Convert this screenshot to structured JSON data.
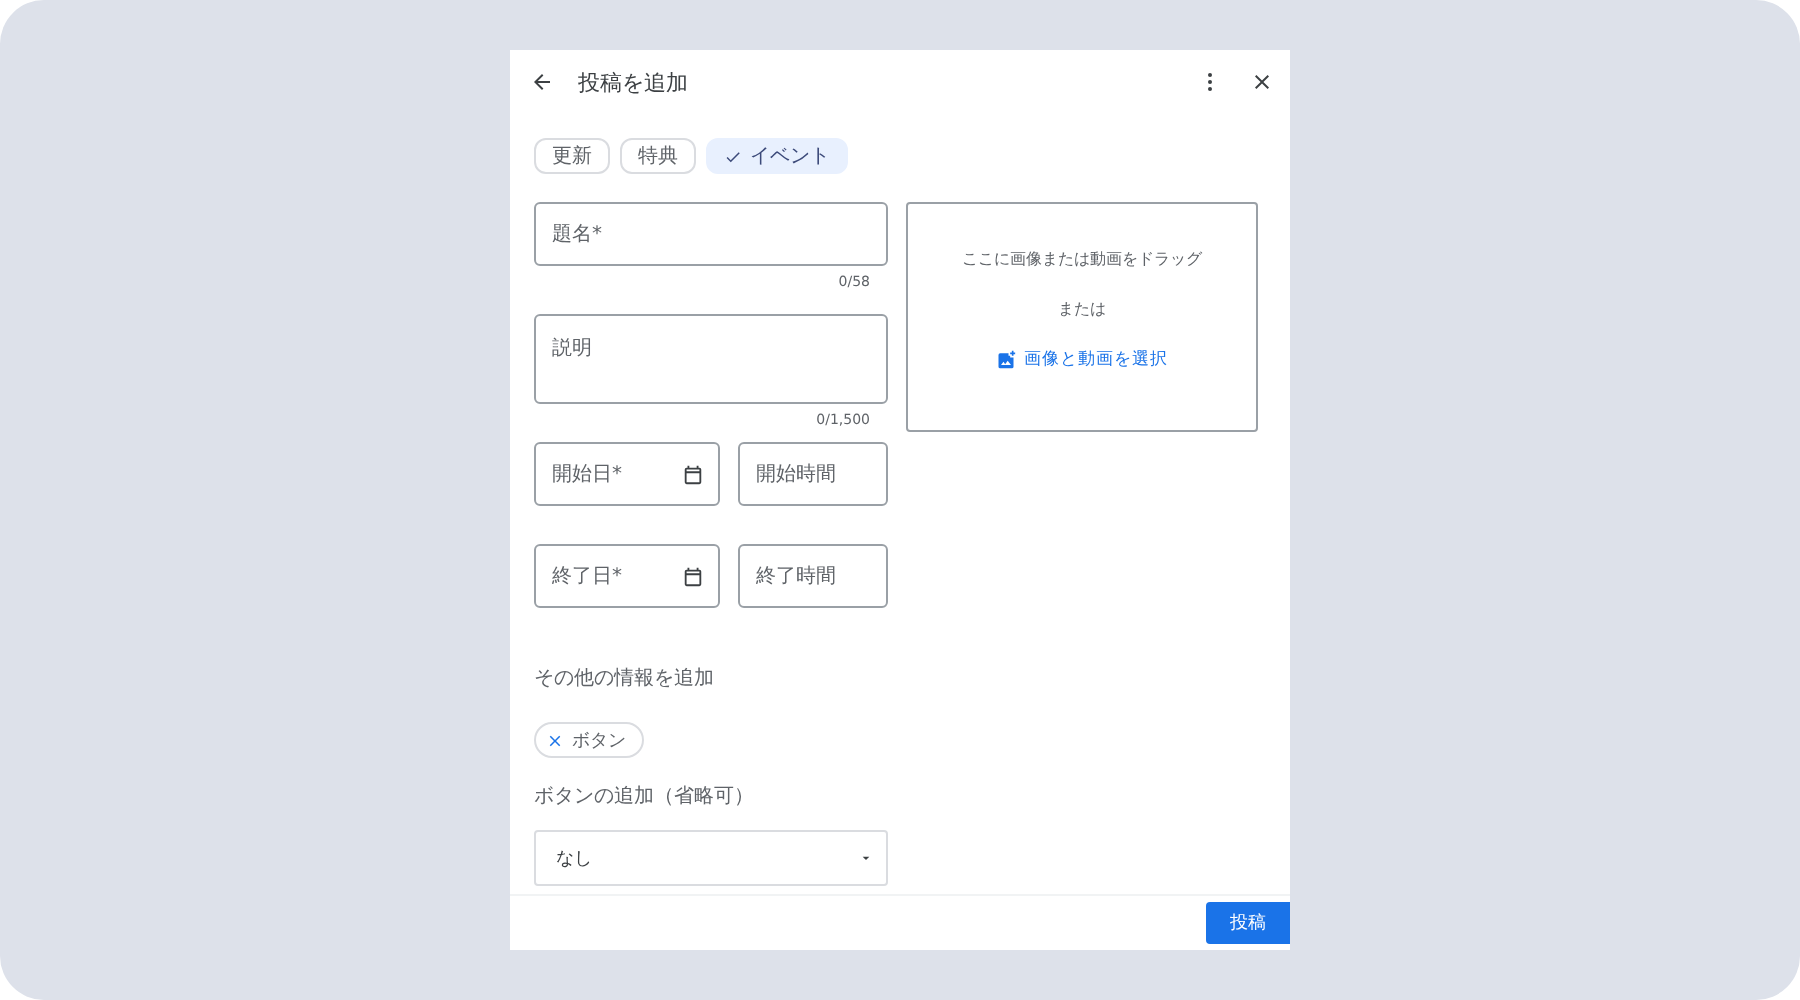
{
  "header": {
    "title": "投稿を追加"
  },
  "post_types": [
    {
      "label": "更新",
      "selected": false
    },
    {
      "label": "特典",
      "selected": false
    },
    {
      "label": "イベント",
      "selected": true
    }
  ],
  "fields": [
    {
      "kind": "text",
      "placeholder": "題名*",
      "counter": "0/58"
    },
    {
      "kind": "textarea",
      "placeholder": "説明",
      "counter": "0/1,500"
    }
  ],
  "schedule_rows": [
    {
      "date_placeholder": "開始日*",
      "time_placeholder": "開始時間"
    },
    {
      "date_placeholder": "終了日*",
      "time_placeholder": "終了時間"
    }
  ],
  "media": {
    "hint": "ここに画像または動画をドラッグ",
    "separator": "または",
    "select_link": "画像と動画を選択"
  },
  "extras": {
    "heading": "その他の情報を追加",
    "chips": [
      {
        "label": "ボタン"
      }
    ]
  },
  "button_field": {
    "label": "ボタンの追加（省略可）",
    "value": "なし"
  },
  "footer": {
    "submit": "投稿"
  }
}
